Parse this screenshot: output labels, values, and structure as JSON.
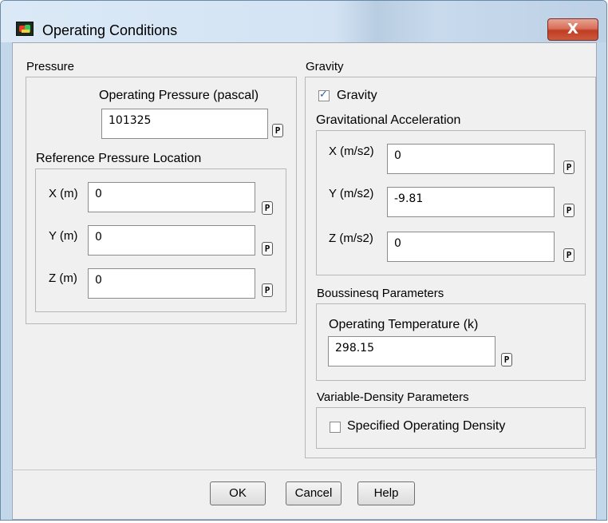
{
  "window": {
    "title": "Operating Conditions",
    "close_glyph": "X",
    "accent": "#c03d23"
  },
  "pressure": {
    "group_label": "Pressure",
    "operating_label": "Operating Pressure (pascal)",
    "operating_value": "101325",
    "p_label": "P",
    "ref_group_label": "Reference Pressure Location",
    "x_label": "X (m)",
    "x_value": "0",
    "y_label": "Y (m)",
    "y_value": "0",
    "z_label": "Z (m)",
    "z_value": "0"
  },
  "gravity": {
    "group_label": "Gravity",
    "checkbox_label": "Gravity",
    "checked": true,
    "accel_group_label": "Gravitational Acceleration",
    "x_label": "X (m/s2)",
    "x_value": "0",
    "y_label": "Y (m/s2)",
    "y_value": "-9.81",
    "z_label": "Z (m/s2)",
    "z_value": "0"
  },
  "boussinesq": {
    "group_label": "Boussinesq Parameters",
    "temp_label": "Operating Temperature (k)",
    "temp_value": "298.15"
  },
  "variable_density": {
    "group_label": "Variable-Density Parameters",
    "checkbox_label": "Specified Operating Density",
    "checked": false
  },
  "buttons": {
    "ok": "OK",
    "cancel": "Cancel",
    "help": "Help"
  }
}
